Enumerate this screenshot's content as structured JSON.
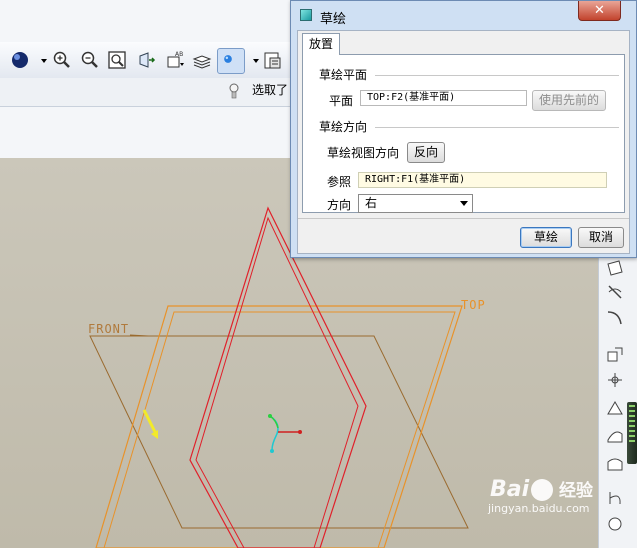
{
  "toolbar": {
    "select_label": "选取了",
    "icons": [
      "sphere-icon",
      "zoom-in-icon",
      "zoom-out-icon",
      "zoom-fit-icon",
      "view-normal-icon",
      "named-view-icon",
      "layers-icon",
      "display-style-icon",
      "save-view-icon"
    ]
  },
  "viewport": {
    "front_label": "FRONT",
    "top_label": "TOP"
  },
  "dialog": {
    "title": "草绘",
    "close_glyph": "✕",
    "tab_label": "放置",
    "sketch_plane": {
      "group_title": "草绘平面",
      "plane_label": "平面",
      "plane_value": "TOP:F2(基准平面)",
      "use_previous_button": "使用先前的"
    },
    "sketch_orientation": {
      "group_title": "草绘方向",
      "view_direction_label": "草绘视图方向",
      "flip_button": "反向",
      "reference_label": "参照",
      "reference_value": "RIGHT:F1(基准平面)",
      "orientation_label": "方向",
      "orientation_value": "右"
    },
    "sketch_button": "草绘",
    "cancel_button": "取消"
  },
  "watermark": {
    "logo_left": "Bai",
    "logo_right": "经验",
    "url": "jingyan.baidu.com"
  },
  "colors": {
    "dialog_frame": "#cfe0f3",
    "viewport_bg": "#c8c3b5",
    "datum_plane": "#e8922a",
    "sketch_red": "#e0202a"
  }
}
